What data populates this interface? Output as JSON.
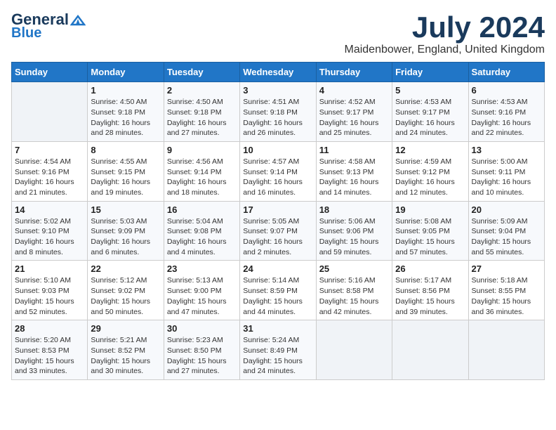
{
  "header": {
    "logo_line1": "General",
    "logo_line2": "Blue",
    "month": "July 2024",
    "location": "Maidenbower, England, United Kingdom"
  },
  "weekdays": [
    "Sunday",
    "Monday",
    "Tuesday",
    "Wednesday",
    "Thursday",
    "Friday",
    "Saturday"
  ],
  "weeks": [
    [
      {
        "day": "",
        "sunrise": "",
        "sunset": "",
        "daylight": ""
      },
      {
        "day": "1",
        "sunrise": "Sunrise: 4:50 AM",
        "sunset": "Sunset: 9:18 PM",
        "daylight": "Daylight: 16 hours and 28 minutes."
      },
      {
        "day": "2",
        "sunrise": "Sunrise: 4:50 AM",
        "sunset": "Sunset: 9:18 PM",
        "daylight": "Daylight: 16 hours and 27 minutes."
      },
      {
        "day": "3",
        "sunrise": "Sunrise: 4:51 AM",
        "sunset": "Sunset: 9:18 PM",
        "daylight": "Daylight: 16 hours and 26 minutes."
      },
      {
        "day": "4",
        "sunrise": "Sunrise: 4:52 AM",
        "sunset": "Sunset: 9:17 PM",
        "daylight": "Daylight: 16 hours and 25 minutes."
      },
      {
        "day": "5",
        "sunrise": "Sunrise: 4:53 AM",
        "sunset": "Sunset: 9:17 PM",
        "daylight": "Daylight: 16 hours and 24 minutes."
      },
      {
        "day": "6",
        "sunrise": "Sunrise: 4:53 AM",
        "sunset": "Sunset: 9:16 PM",
        "daylight": "Daylight: 16 hours and 22 minutes."
      }
    ],
    [
      {
        "day": "7",
        "sunrise": "Sunrise: 4:54 AM",
        "sunset": "Sunset: 9:16 PM",
        "daylight": "Daylight: 16 hours and 21 minutes."
      },
      {
        "day": "8",
        "sunrise": "Sunrise: 4:55 AM",
        "sunset": "Sunset: 9:15 PM",
        "daylight": "Daylight: 16 hours and 19 minutes."
      },
      {
        "day": "9",
        "sunrise": "Sunrise: 4:56 AM",
        "sunset": "Sunset: 9:14 PM",
        "daylight": "Daylight: 16 hours and 18 minutes."
      },
      {
        "day": "10",
        "sunrise": "Sunrise: 4:57 AM",
        "sunset": "Sunset: 9:14 PM",
        "daylight": "Daylight: 16 hours and 16 minutes."
      },
      {
        "day": "11",
        "sunrise": "Sunrise: 4:58 AM",
        "sunset": "Sunset: 9:13 PM",
        "daylight": "Daylight: 16 hours and 14 minutes."
      },
      {
        "day": "12",
        "sunrise": "Sunrise: 4:59 AM",
        "sunset": "Sunset: 9:12 PM",
        "daylight": "Daylight: 16 hours and 12 minutes."
      },
      {
        "day": "13",
        "sunrise": "Sunrise: 5:00 AM",
        "sunset": "Sunset: 9:11 PM",
        "daylight": "Daylight: 16 hours and 10 minutes."
      }
    ],
    [
      {
        "day": "14",
        "sunrise": "Sunrise: 5:02 AM",
        "sunset": "Sunset: 9:10 PM",
        "daylight": "Daylight: 16 hours and 8 minutes."
      },
      {
        "day": "15",
        "sunrise": "Sunrise: 5:03 AM",
        "sunset": "Sunset: 9:09 PM",
        "daylight": "Daylight: 16 hours and 6 minutes."
      },
      {
        "day": "16",
        "sunrise": "Sunrise: 5:04 AM",
        "sunset": "Sunset: 9:08 PM",
        "daylight": "Daylight: 16 hours and 4 minutes."
      },
      {
        "day": "17",
        "sunrise": "Sunrise: 5:05 AM",
        "sunset": "Sunset: 9:07 PM",
        "daylight": "Daylight: 16 hours and 2 minutes."
      },
      {
        "day": "18",
        "sunrise": "Sunrise: 5:06 AM",
        "sunset": "Sunset: 9:06 PM",
        "daylight": "Daylight: 15 hours and 59 minutes."
      },
      {
        "day": "19",
        "sunrise": "Sunrise: 5:08 AM",
        "sunset": "Sunset: 9:05 PM",
        "daylight": "Daylight: 15 hours and 57 minutes."
      },
      {
        "day": "20",
        "sunrise": "Sunrise: 5:09 AM",
        "sunset": "Sunset: 9:04 PM",
        "daylight": "Daylight: 15 hours and 55 minutes."
      }
    ],
    [
      {
        "day": "21",
        "sunrise": "Sunrise: 5:10 AM",
        "sunset": "Sunset: 9:03 PM",
        "daylight": "Daylight: 15 hours and 52 minutes."
      },
      {
        "day": "22",
        "sunrise": "Sunrise: 5:12 AM",
        "sunset": "Sunset: 9:02 PM",
        "daylight": "Daylight: 15 hours and 50 minutes."
      },
      {
        "day": "23",
        "sunrise": "Sunrise: 5:13 AM",
        "sunset": "Sunset: 9:00 PM",
        "daylight": "Daylight: 15 hours and 47 minutes."
      },
      {
        "day": "24",
        "sunrise": "Sunrise: 5:14 AM",
        "sunset": "Sunset: 8:59 PM",
        "daylight": "Daylight: 15 hours and 44 minutes."
      },
      {
        "day": "25",
        "sunrise": "Sunrise: 5:16 AM",
        "sunset": "Sunset: 8:58 PM",
        "daylight": "Daylight: 15 hours and 42 minutes."
      },
      {
        "day": "26",
        "sunrise": "Sunrise: 5:17 AM",
        "sunset": "Sunset: 8:56 PM",
        "daylight": "Daylight: 15 hours and 39 minutes."
      },
      {
        "day": "27",
        "sunrise": "Sunrise: 5:18 AM",
        "sunset": "Sunset: 8:55 PM",
        "daylight": "Daylight: 15 hours and 36 minutes."
      }
    ],
    [
      {
        "day": "28",
        "sunrise": "Sunrise: 5:20 AM",
        "sunset": "Sunset: 8:53 PM",
        "daylight": "Daylight: 15 hours and 33 minutes."
      },
      {
        "day": "29",
        "sunrise": "Sunrise: 5:21 AM",
        "sunset": "Sunset: 8:52 PM",
        "daylight": "Daylight: 15 hours and 30 minutes."
      },
      {
        "day": "30",
        "sunrise": "Sunrise: 5:23 AM",
        "sunset": "Sunset: 8:50 PM",
        "daylight": "Daylight: 15 hours and 27 minutes."
      },
      {
        "day": "31",
        "sunrise": "Sunrise: 5:24 AM",
        "sunset": "Sunset: 8:49 PM",
        "daylight": "Daylight: 15 hours and 24 minutes."
      },
      {
        "day": "",
        "sunrise": "",
        "sunset": "",
        "daylight": ""
      },
      {
        "day": "",
        "sunrise": "",
        "sunset": "",
        "daylight": ""
      },
      {
        "day": "",
        "sunrise": "",
        "sunset": "",
        "daylight": ""
      }
    ]
  ]
}
